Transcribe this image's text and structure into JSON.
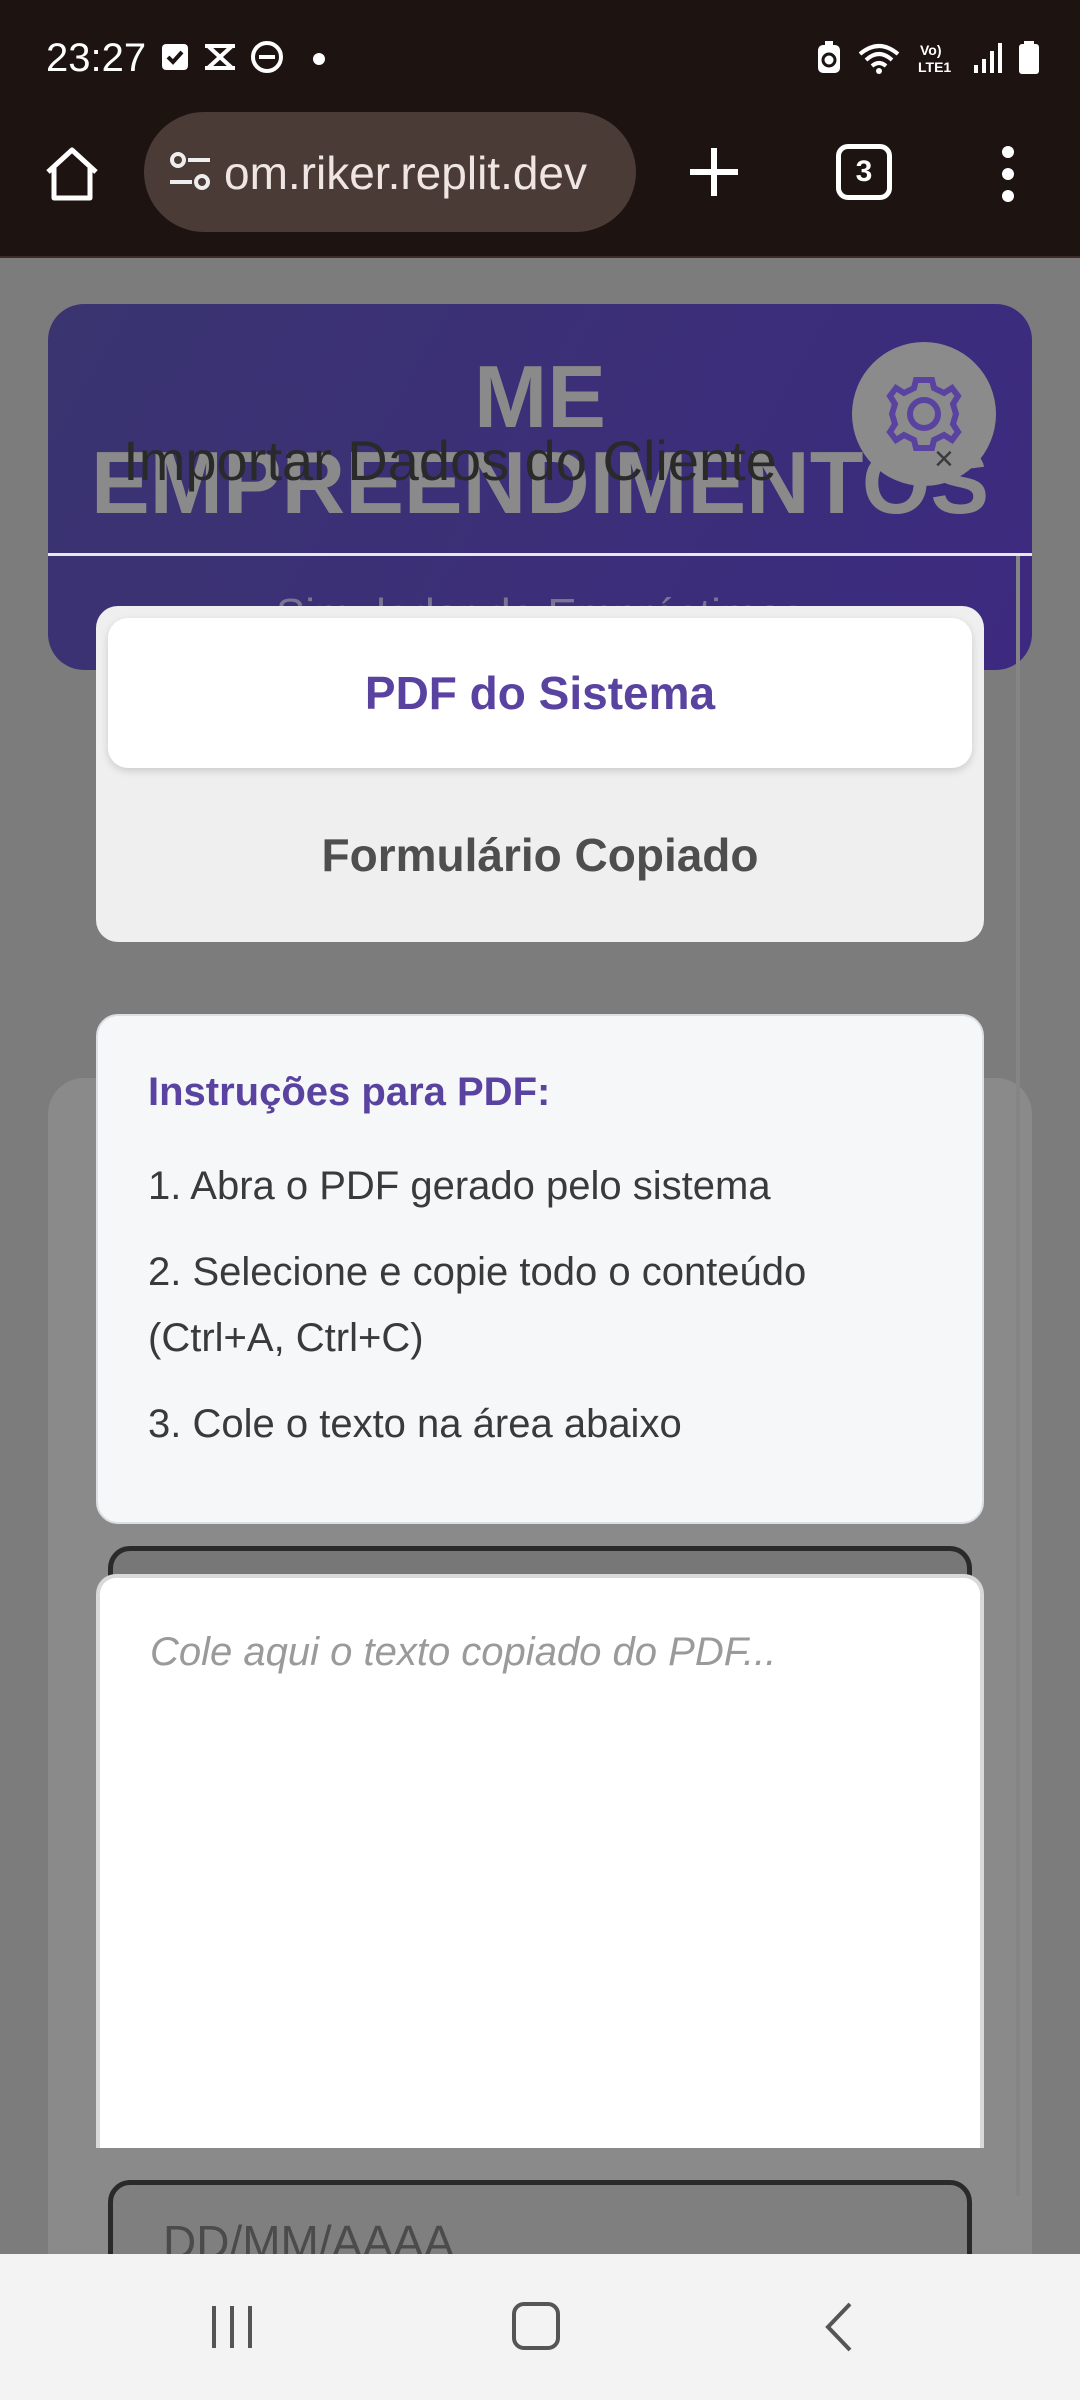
{
  "status_bar": {
    "time": "23:27"
  },
  "browser": {
    "url": "om.riker.replit.dev",
    "tab_count": "3"
  },
  "hero": {
    "brand_line1": "ME",
    "brand_line2": "EMPREENDIMENTOS",
    "subtitle": "Simulador de Empréstimos"
  },
  "modal": {
    "title": "Importar Dados do Cliente",
    "close": "×",
    "tabs": [
      {
        "label": "PDF do Sistema",
        "active": true
      },
      {
        "label": "Formulário Copiado",
        "active": false
      }
    ],
    "instructions": {
      "heading": "Instruções para PDF:",
      "steps": [
        "1. Abra o PDF gerado pelo sistema",
        "2. Selecione e copie todo o conteúdo (Ctrl+A, Ctrl+C)",
        "3. Cole o texto na área abaixo"
      ]
    },
    "textarea_placeholder": "Cole aqui o texto copiado do PDF..."
  },
  "background_form": {
    "date_placeholder": "DD/MM/AAAA"
  },
  "colors": {
    "accent": "#5a43a0",
    "browser_bg": "#1d1310",
    "overlay": "#7c7c7c"
  }
}
